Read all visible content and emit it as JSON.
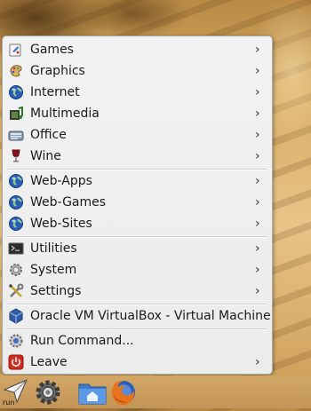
{
  "menu": {
    "items": [
      {
        "label": "Games",
        "icon": "games-icon",
        "submenu": true
      },
      {
        "label": "Graphics",
        "icon": "graphics-palette-icon",
        "submenu": true
      },
      {
        "label": "Internet",
        "icon": "globe-icon",
        "submenu": true
      },
      {
        "label": "Multimedia",
        "icon": "multimedia-icon",
        "submenu": true
      },
      {
        "label": "Office",
        "icon": "office-icon",
        "submenu": true
      },
      {
        "label": "Wine",
        "icon": "wine-glass-icon",
        "submenu": true
      },
      {
        "label": "Web-Apps",
        "icon": "globe-icon",
        "submenu": true
      },
      {
        "label": "Web-Games",
        "icon": "globe-icon",
        "submenu": true
      },
      {
        "label": "Web-Sites",
        "icon": "globe-icon",
        "submenu": true
      },
      {
        "label": "Utilities",
        "icon": "terminal-icon",
        "submenu": true
      },
      {
        "label": "System",
        "icon": "gear-icon",
        "submenu": true
      },
      {
        "label": "Settings",
        "icon": "tools-icon",
        "submenu": true
      },
      {
        "label": "Oracle VM VirtualBox - Virtual Machine",
        "icon": "virtualbox-icon",
        "submenu": false
      },
      {
        "label": "Run Command...",
        "icon": "run-command-icon",
        "submenu": false
      },
      {
        "label": "Leave",
        "icon": "power-icon",
        "submenu": true
      }
    ],
    "submenu_glyph": "›"
  },
  "panel": {
    "run_label": "run",
    "buttons": [
      "run-menu-icon",
      "system-gear-icon",
      "home-folder-icon",
      "firefox-icon"
    ]
  },
  "colors": {
    "menu_bg": "#efefef",
    "text": "#1a1a1a",
    "globe_blue": "#2a5fb8",
    "leave_red": "#d32a1e"
  }
}
